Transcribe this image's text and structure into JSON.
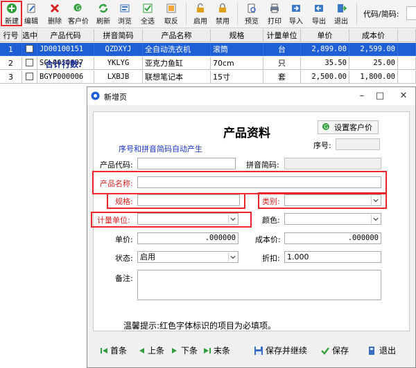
{
  "toolbar": {
    "buttons": [
      {
        "label": "新建"
      },
      {
        "label": "编辑"
      },
      {
        "label": "删除"
      },
      {
        "label": "客户价"
      },
      {
        "label": "刷新"
      },
      {
        "label": "浏览"
      },
      {
        "label": "全选"
      },
      {
        "label": "取反"
      },
      {
        "label": "启用"
      },
      {
        "label": "禁用"
      },
      {
        "label": "预览"
      },
      {
        "label": "打印"
      },
      {
        "label": "导入"
      },
      {
        "label": "导出"
      },
      {
        "label": "退出"
      }
    ],
    "search_label": "代码/简码:",
    "search_value": ""
  },
  "grid": {
    "columns": [
      "行号",
      "选中",
      "产品代码",
      "拼音简码",
      "产品名称",
      "规格",
      "计量单位",
      "单价",
      "成本价"
    ],
    "rows": [
      {
        "idx": "1",
        "code": "JD00100151",
        "pinyin": "QZDXYJ",
        "name": "全自动洗衣机",
        "spec": "滚筒",
        "unit": "台",
        "price": "2,899.00",
        "cost": "2,599.00",
        "selected": true
      },
      {
        "idx": "2",
        "code": "SCL0010007",
        "pinyin": "YKLYG",
        "name": "亚克力鱼缸",
        "spec": "70cm",
        "unit": "只",
        "price": "35.50",
        "cost": "25.00",
        "selected": false
      },
      {
        "idx": "3",
        "code": "BGYP000006",
        "pinyin": "LXBJB",
        "name": "联想笔记本",
        "spec": "15寸",
        "unit": "套",
        "price": "2,500.00",
        "cost": "1,800.00",
        "selected": false
      }
    ],
    "total_label": "合计行数:"
  },
  "dialog": {
    "title": "新增页",
    "form_title": "产品资料",
    "subtitle": "序号和拼音简码自动产生",
    "customer_price_button": "设置客户价",
    "labels": {
      "seq": "序号:",
      "code": "产品代码:",
      "pinyin": "拼音简码:",
      "name": "产品名称:",
      "spec": "规格:",
      "category": "类别:",
      "unit": "计量单位:",
      "color": "颜色:",
      "price": "单价:",
      "cost": "成本价:",
      "status": "状态:",
      "discount": "折扣:",
      "remark": "备注:"
    },
    "values": {
      "seq": "",
      "code": "",
      "pinyin": "",
      "name": "",
      "spec": "",
      "category": "",
      "unit": "",
      "color": "",
      "price": ".000000",
      "cost": ".000000",
      "status": "启用",
      "discount": "1.000",
      "remark": ""
    },
    "hint": "温馨提示:红色字体标识的项目为必填项。",
    "footer_buttons": {
      "first": "首条",
      "prev": "上条",
      "next": "下条",
      "last": "末条",
      "save_continue": "保存并继续",
      "save": "保存",
      "exit": "退出"
    }
  },
  "colors": {
    "selection": "#1f5fd6",
    "required_label": "#d81e1e",
    "highlight_border": "#e8262b",
    "subtitle_blue": "#1835c9"
  }
}
